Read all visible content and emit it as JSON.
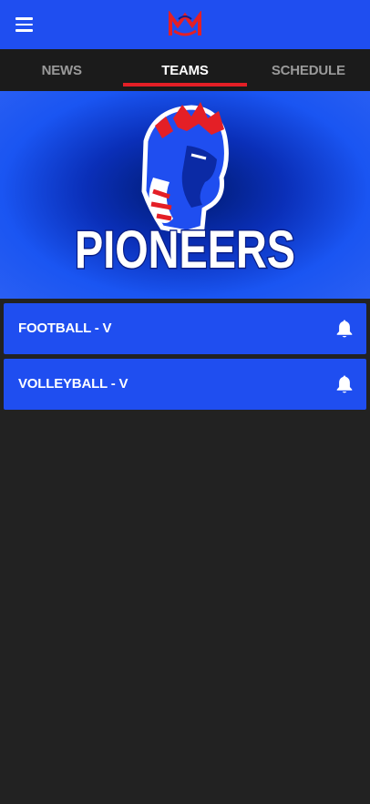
{
  "header": {
    "menu_icon": "hamburger-menu-icon",
    "logo_icon": "school-monogram-logo"
  },
  "tabs": [
    {
      "label": "NEWS",
      "active": false
    },
    {
      "label": "TEAMS",
      "active": true
    },
    {
      "label": "SCHEDULE",
      "active": false
    }
  ],
  "banner": {
    "wordmark": "PIONEERS",
    "mascot_icon": "pioneer-head-mascot"
  },
  "teams": [
    {
      "label": "FOOTBALL - V",
      "icon": "bell-icon"
    },
    {
      "label": "VOLLEYBALL - V",
      "icon": "bell-icon"
    }
  ],
  "colors": {
    "primary": "#1f4ef0",
    "accent": "#e41f26",
    "tab_bar": "#1b1b1b",
    "background": "#222222"
  }
}
